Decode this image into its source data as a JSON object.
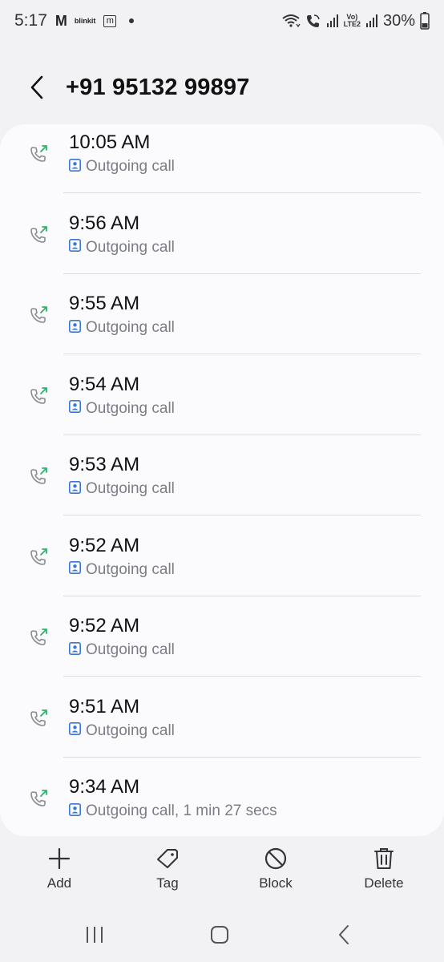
{
  "status_bar": {
    "time": "5:17",
    "app_m": "M",
    "app_blinkit": "blinkit",
    "app_box": "m",
    "lte_top": "Vo)",
    "lte_bottom": "LTE2",
    "battery": "30%"
  },
  "header": {
    "title": "+91 95132 99897"
  },
  "calls": [
    {
      "time": "10:05 AM",
      "type": "Outgoing call"
    },
    {
      "time": "9:56 AM",
      "type": "Outgoing call"
    },
    {
      "time": "9:55 AM",
      "type": "Outgoing call"
    },
    {
      "time": "9:54 AM",
      "type": "Outgoing call"
    },
    {
      "time": "9:53 AM",
      "type": "Outgoing call"
    },
    {
      "time": "9:52 AM",
      "type": "Outgoing call"
    },
    {
      "time": "9:52 AM",
      "type": "Outgoing call"
    },
    {
      "time": "9:51 AM",
      "type": "Outgoing call"
    },
    {
      "time": "9:34 AM",
      "type": "Outgoing call, 1 min 27 secs"
    }
  ],
  "actions": {
    "add": "Add",
    "tag": "Tag",
    "block": "Block",
    "delete": "Delete"
  },
  "colors": {
    "accent_green": "#2fb26a",
    "contact_blue": "#3a76d4"
  },
  "icons": [
    "back-arrow-icon",
    "outgoing-call-icon",
    "contact-icon",
    "add-icon",
    "tag-icon",
    "block-icon",
    "delete-icon",
    "recents-icon",
    "home-icon",
    "back-nav-icon"
  ]
}
